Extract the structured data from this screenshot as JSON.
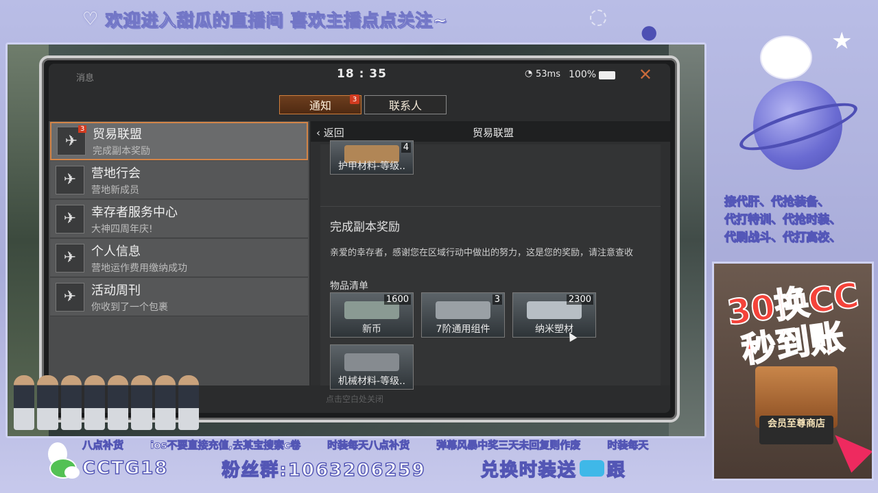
{
  "overlay": {
    "banner": "欢迎进入甜瓜的直播间 喜欢主播点点关注~",
    "promo_lines": [
      "接代肝、代抢装备、",
      "代打特训、代抢时装、",
      "代刷战斗、代打高校、"
    ],
    "ad": {
      "line1": "30换CC",
      "line2": "秒到账",
      "store_label": "会员至尊商店"
    },
    "ticker": [
      "八点补货",
      "ios不要直接充值,去某宝搜索c卷",
      "时装每天八点补货",
      "弹幕风暴中奖三天未回复则作废",
      "时装每天"
    ],
    "bottom": {
      "wechat_id": "CCTG18",
      "fans_group": "粉丝群:1063206259",
      "exchange": "兑换时装送",
      "follow": "跟"
    }
  },
  "game": {
    "status": {
      "left_title": "消息",
      "time": "18 : 35",
      "ping": "53ms",
      "battery": "100%"
    },
    "tabs": [
      {
        "label": "通知",
        "badge": "3",
        "active": true
      },
      {
        "label": "联系人",
        "badge": "",
        "active": false
      }
    ],
    "messages": [
      {
        "name": "贸易联盟",
        "sub": "完成副本奖励",
        "badge": "3",
        "active": true
      },
      {
        "name": "营地行会",
        "sub": "营地新成员",
        "badge": "",
        "active": false
      },
      {
        "name": "幸存者服务中心",
        "sub": "大神四周年庆!",
        "badge": "",
        "active": false
      },
      {
        "name": "个人信息",
        "sub": "营地运作费用缴纳成功",
        "badge": "",
        "active": false
      },
      {
        "name": "活动周刊",
        "sub": "你收到了一个包裹",
        "badge": "",
        "active": false
      }
    ],
    "detail": {
      "back_label": "返回",
      "title": "贸易联盟",
      "prev_item": {
        "label": "护甲材料-等级..",
        "qty": "4"
      },
      "section_title": "完成副本奖励",
      "body": "亲爱的幸存者，感谢您在区域行动中做出的努力，这是您的奖励，请注意查收",
      "items_title": "物品清单",
      "items": [
        {
          "label": "新币",
          "qty": "1600",
          "color": "#7e8f8a"
        },
        {
          "label": "7阶通用组件",
          "qty": "3",
          "color": "#8d9297"
        },
        {
          "label": "纳米塑材",
          "qty": "2300",
          "color": "#a9b0b6"
        },
        {
          "label": "机械材料-等级..",
          "qty": "",
          "color": "#7a7f84"
        }
      ],
      "footer_tip": "点击空白处关闭"
    }
  }
}
